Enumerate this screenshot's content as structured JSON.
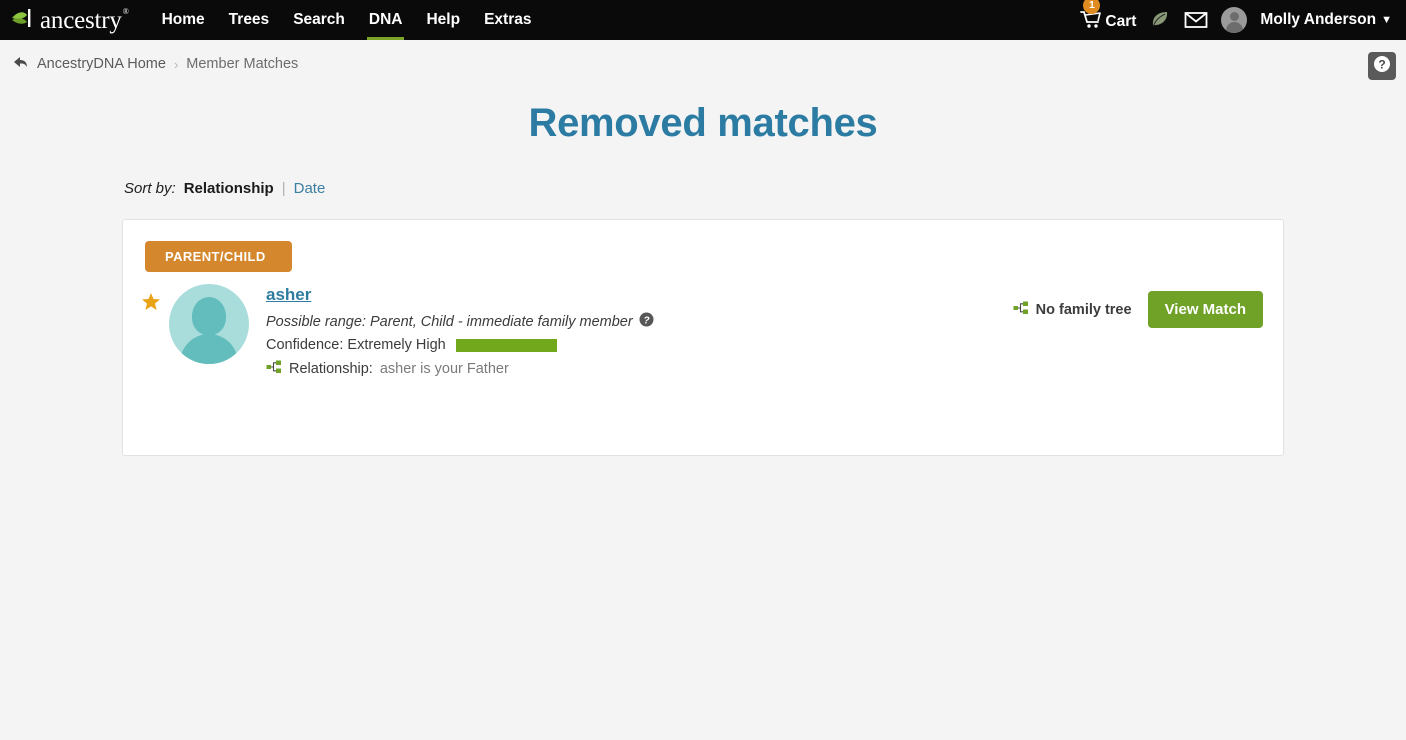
{
  "brand": {
    "logo_word": "ancestry",
    "logo_mark": "®",
    "accent_green": "#7ba428",
    "title_blue": "#2b7ba3",
    "badge_orange": "#d4872c",
    "button_green": "#6fa227",
    "confidence_green": "#72a81b",
    "avatar_teal": "#62bdbc",
    "star_gold": "#e8a317"
  },
  "topnav": {
    "items": [
      {
        "label": "Home",
        "active": false
      },
      {
        "label": "Trees",
        "active": false
      },
      {
        "label": "Search",
        "active": false
      },
      {
        "label": "DNA",
        "active": true
      },
      {
        "label": "Help",
        "active": false
      },
      {
        "label": "Extras",
        "active": false
      }
    ],
    "cart": {
      "label": "Cart",
      "badge": "1",
      "icon": "shopping-cart-icon"
    },
    "leaf_icon": "leaf-hint-icon",
    "mail_icon": "envelope-icon",
    "avatar_icon": "user-avatar-icon",
    "user": {
      "name": "Molly Anderson",
      "chevron": "⌄"
    }
  },
  "breadcrumb": {
    "back_icon": "back-arrow-icon",
    "home": "AncestryDNA Home",
    "separator": "›",
    "current": "Member Matches"
  },
  "help_corner": {
    "icon": "question-mark-icon",
    "label": "?"
  },
  "page": {
    "title": "Removed matches"
  },
  "sort": {
    "label": "Sort by:",
    "active": "Relationship",
    "pipe": "|",
    "link": "Date"
  },
  "match": {
    "relationship_badge": "PARENT/CHILD",
    "starred": true,
    "star_icon": "star-filled-icon",
    "avatar_icon": "person-silhouette-icon",
    "name": "asher",
    "possible_range": "Possible range: Parent, Child - immediate family member",
    "possible_range_help_icon": "question-circle-icon",
    "confidence_label": "Confidence: Extremely High",
    "confidence_bar_pct": 100,
    "relationship_icon": "family-tree-icon",
    "relationship_prefix": "Relationship:",
    "relationship_detail": "asher is your Father",
    "no_family_tree": "No family tree",
    "no_family_tree_icon": "family-tree-icon",
    "view_match_button": "View Match"
  }
}
